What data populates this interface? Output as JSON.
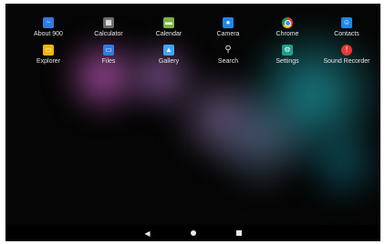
{
  "apps": [
    {
      "label": "About 900",
      "icon": "chart-icon",
      "color": "#2f7de1"
    },
    {
      "label": "Calculator",
      "icon": "calculator-icon",
      "color": "#6b6b6b"
    },
    {
      "label": "Calendar",
      "icon": "calendar-icon",
      "color": "#7cb342"
    },
    {
      "label": "Camera",
      "icon": "camera-icon",
      "color": "#1e88e5"
    },
    {
      "label": "Chrome",
      "icon": "chrome-icon",
      "color": "#db4437"
    },
    {
      "label": "Contacts",
      "icon": "contacts-icon",
      "color": "#1e88e5"
    },
    {
      "label": "Explorer",
      "icon": "folder-icon",
      "color": "#f4b400"
    },
    {
      "label": "Files",
      "icon": "files-icon",
      "color": "#2f7de1"
    },
    {
      "label": "Gallery",
      "icon": "gallery-icon",
      "color": "#42a5f5"
    },
    {
      "label": "Search",
      "icon": "search-icon",
      "color": "#e0e0e0"
    },
    {
      "label": "Settings",
      "icon": "gear-icon",
      "color": "#1e9e8c"
    },
    {
      "label": "Sound Recorder",
      "icon": "microphone-icon",
      "color": "#e53935"
    }
  ],
  "navbar": {
    "back": "◀",
    "home": "home",
    "recents": "recents"
  }
}
